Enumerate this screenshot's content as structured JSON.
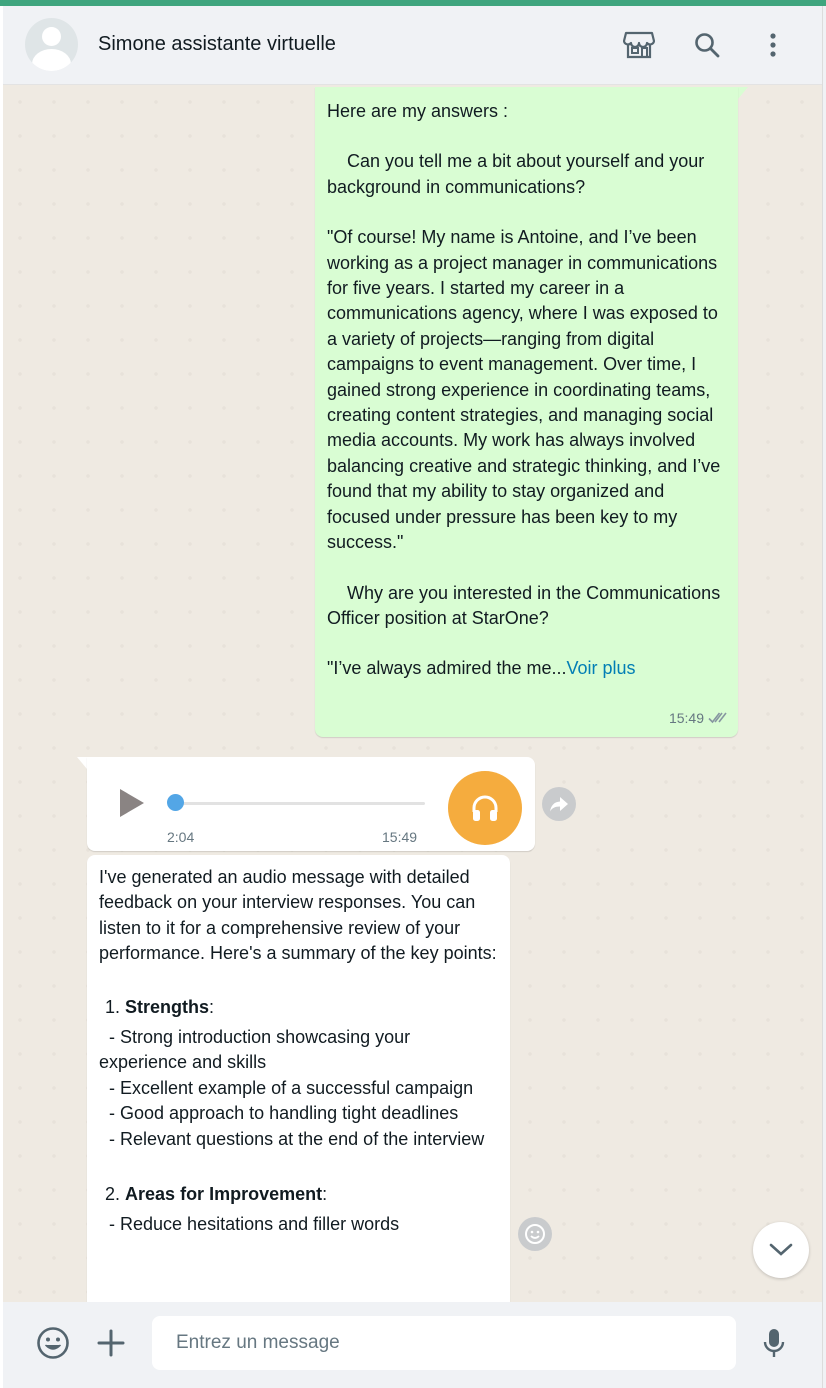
{
  "header": {
    "contact_name": "Simone assistante virtuelle",
    "icons": [
      "store-icon",
      "search-icon",
      "more-vert-icon"
    ]
  },
  "outgoing": {
    "paragraphs": [
      "Here are my answers :",
      "    Can you tell me a bit about yourself and your background in communications?",
      "\"Of course! My name is Antoine, and I’ve been working as a project manager in communications for five years. I started my career in a communications agency, where I was exposed to a variety of projects—ranging from digital campaigns to event management. Over time, I gained strong experience in coordinating teams, creating content strategies, and managing social media accounts. My work has always involved balancing creative and strategic thinking, and I’ve found that my ability to stay organized and focused under pressure has been key to my success.\"",
      "    Why are you interested in the Communications Officer position at StarOne?"
    ],
    "last_line": "\"I’ve always admired the me...",
    "voir_plus": "Voir plus",
    "time": "15:49",
    "status": "read"
  },
  "audio": {
    "duration": "2:04",
    "time": "15:49",
    "progress": 0
  },
  "incoming": {
    "intro": "I've generated an audio message with detailed feedback on your interview responses. You can listen to it for a comprehensive review of your performance. Here's a summary of the key points:",
    "sections": [
      {
        "number": "1.",
        "title": "Strengths",
        "suffix": ":",
        "bullets": [
          "  - Strong introduction showcasing your experience and skills",
          "  - Excellent example of a successful campaign",
          "  - Good approach to handling tight deadlines",
          "  - Relevant questions at the end of the interview"
        ]
      },
      {
        "number": "2.",
        "title": "Areas for Improvement",
        "suffix": ":",
        "bullets": [
          "  - Reduce hesitations and filler words"
        ]
      }
    ]
  },
  "composer": {
    "placeholder": "Entrez un message"
  },
  "colors": {
    "accent": "#3fa57e",
    "outgoing_bubble": "#d9fdd3",
    "link": "#027eb5",
    "headphone": "#f5ac3e",
    "audio_knob": "#53a6e6"
  }
}
